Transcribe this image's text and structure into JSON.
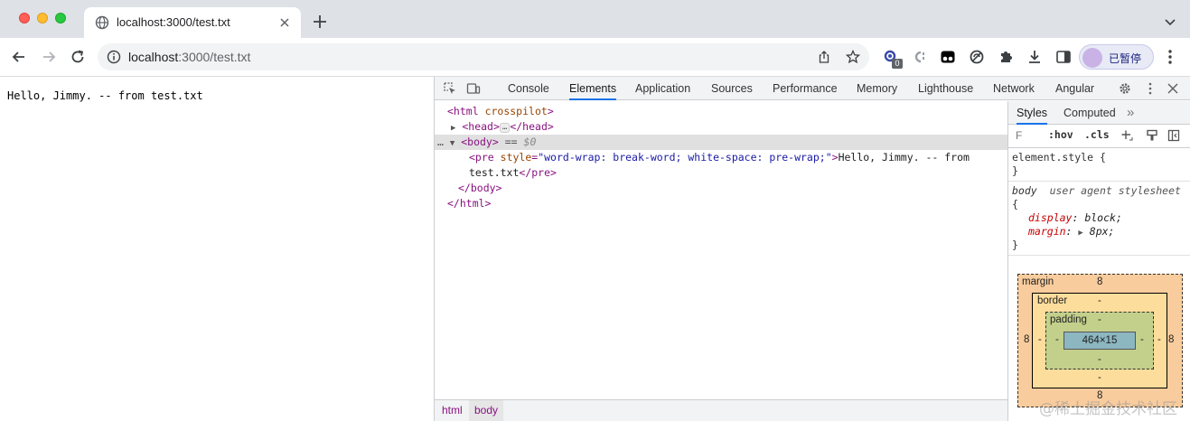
{
  "browser": {
    "tab": {
      "title": "localhost:3000/test.txt",
      "favicon": "globe-icon"
    },
    "address_bar": {
      "host": "localhost",
      "path": ":3000/test.txt"
    },
    "extension_badge": "0",
    "profile": {
      "label": "已暂停"
    }
  },
  "page": {
    "content": "Hello, Jimmy. -- from test.txt"
  },
  "devtools": {
    "tabs": [
      "Console",
      "Elements",
      "Application",
      "Sources",
      "Performance",
      "Memory",
      "Lighthouse",
      "Network",
      "Angular"
    ],
    "active_tab": "Elements",
    "dom": {
      "html_open_tag": "<html",
      "html_attr": "crosspilot",
      "head_open": "<head>",
      "head_ellipsis": "…",
      "head_close": "</head>",
      "body_open": "<body>",
      "body_eq": "==",
      "body_dollar": "$0",
      "pre_open": "<pre",
      "pre_attr_name": "style",
      "pre_attr_value": "\"word-wrap: break-word; white-space: pre-wrap;\"",
      "pre_text_1": "Hello, Jimmy. -- from",
      "pre_text_2": "test.txt",
      "pre_close": "</pre>",
      "body_close": "</body>",
      "html_close": "</html>",
      "ellipsis_marker": "…"
    },
    "breadcrumbs": [
      "html",
      "body"
    ],
    "styles_pane": {
      "tabs": [
        "Styles",
        "Computed"
      ],
      "more": "»",
      "filter_placeholder": "F",
      "hov": ":hov",
      "cls": ".cls",
      "element_style_selector": "element.style",
      "open_brace": "{",
      "close_brace": "}",
      "rule_selector": "body",
      "rule_origin": "user agent stylesheet",
      "properties": [
        {
          "name": "display",
          "value": "block;"
        },
        {
          "name": "margin",
          "value": "8px;"
        }
      ]
    },
    "box_model": {
      "margin_label": "margin",
      "margin_top": "8",
      "margin_right": "8",
      "margin_bottom": "8",
      "margin_left": "8",
      "border_label": "border",
      "border_top": "-",
      "border_bottom": "-",
      "border_left": "-",
      "border_right": "-",
      "padding_label": "padding",
      "padding_top": "-",
      "padding_bottom": "-",
      "padding_left": "-",
      "padding_right": "-",
      "content": "464×15"
    }
  },
  "watermark": "@稀土掘金技术社区"
}
